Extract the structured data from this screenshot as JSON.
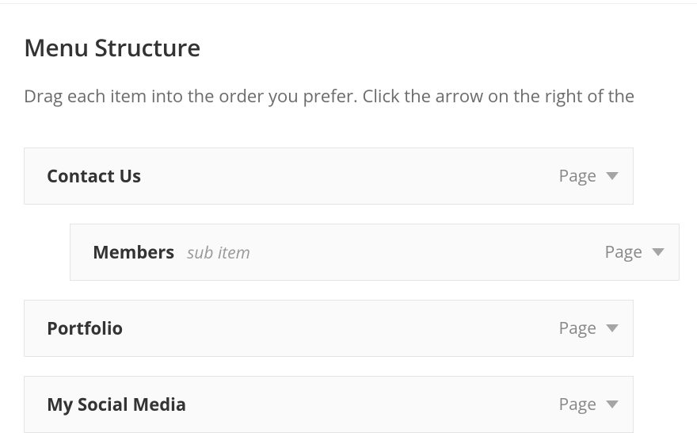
{
  "heading": "Menu Structure",
  "description": "Drag each item into the order you prefer. Click the arrow on the right of the",
  "items": [
    {
      "title": "Contact Us",
      "type": "Page",
      "sub": false,
      "sub_label": ""
    },
    {
      "title": "Members",
      "type": "Page",
      "sub": true,
      "sub_label": "sub item"
    },
    {
      "title": "Portfolio",
      "type": "Page",
      "sub": false,
      "sub_label": ""
    },
    {
      "title": "My Social Media",
      "type": "Page",
      "sub": false,
      "sub_label": ""
    }
  ]
}
